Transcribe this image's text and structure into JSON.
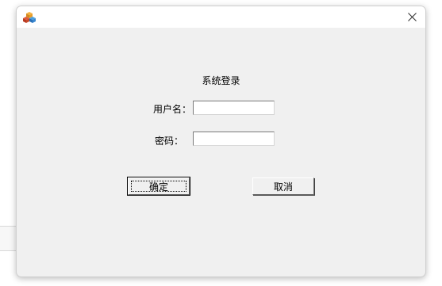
{
  "window": {
    "close_symbol": "✕",
    "app_icon": "app-cubes-icon"
  },
  "form": {
    "title": "系统登录",
    "username_label": "用户名：",
    "username_value": "",
    "password_label": "密码：",
    "password_value": ""
  },
  "buttons": {
    "ok_label": "确定",
    "cancel_label": "取消"
  }
}
